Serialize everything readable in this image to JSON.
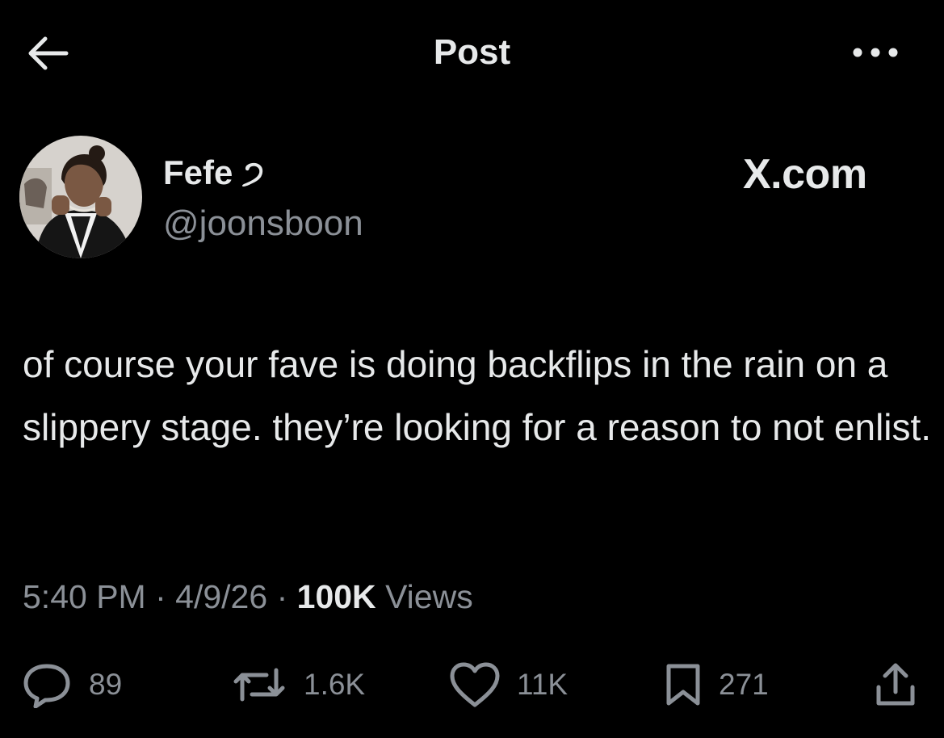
{
  "header": {
    "title": "Post"
  },
  "author": {
    "name": "Fefe",
    "name_glyph": "੭",
    "handle": "@joonsboon"
  },
  "brand": {
    "text": "X.com"
  },
  "tweet": {
    "text": "of course your fave is doing backflips in the rain on a slippery stage. they’re looking for a reason to not enlist."
  },
  "meta": {
    "time": "5:40 PM",
    "date": "4/9/26",
    "views_count": "100K",
    "views_label": "Views",
    "separator": "·"
  },
  "actions": {
    "replies": "89",
    "reposts": "1.6K",
    "likes": "11K",
    "bookmarks": "271"
  },
  "icons": {
    "back": "arrow-left-icon",
    "more": "more-icon",
    "reply": "reply-icon",
    "repost": "repost-icon",
    "like": "heart-icon",
    "bookmark": "bookmark-icon",
    "share": "share-icon"
  },
  "colors": {
    "background": "#000000",
    "text": "#e7e9ea",
    "secondary": "#8b9097"
  }
}
